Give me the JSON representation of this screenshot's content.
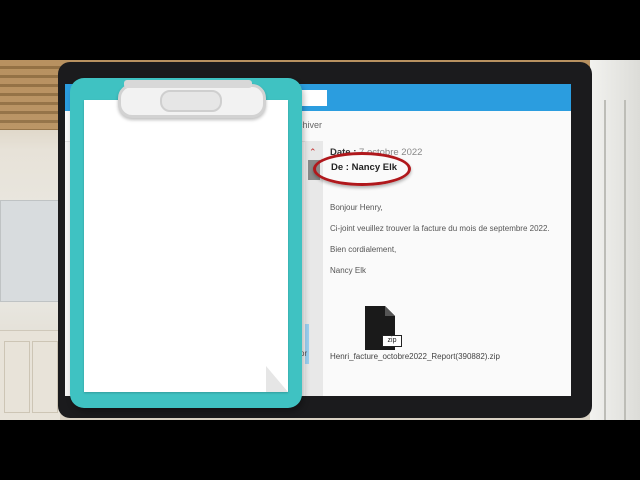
{
  "email": {
    "date_label": "Date",
    "date_value": "7 octobre 2022",
    "from_label": "De",
    "from_name": "Nancy Elk",
    "greeting": "Bonjour Henry,",
    "body_line": "Ci-joint veuillez trouver la facture du mois de septembre 2022.",
    "closing": "Bien cordialement,",
    "signature": "Nancy Elk",
    "attachment": {
      "type_label": "zip",
      "filename": "Henri_facture_octobre2022_Report(390882).zip"
    }
  },
  "toolbar": {
    "archive_label": "chiver"
  },
  "sidebar": {
    "partial_label": "or"
  },
  "colors": {
    "header_blue": "#2b9ddf",
    "clipboard_teal": "#3fc2c2",
    "highlight_red": "#b0181c"
  },
  "icons": {
    "collapse": "chevron-up-icon",
    "attachment": "zip-file-icon"
  }
}
